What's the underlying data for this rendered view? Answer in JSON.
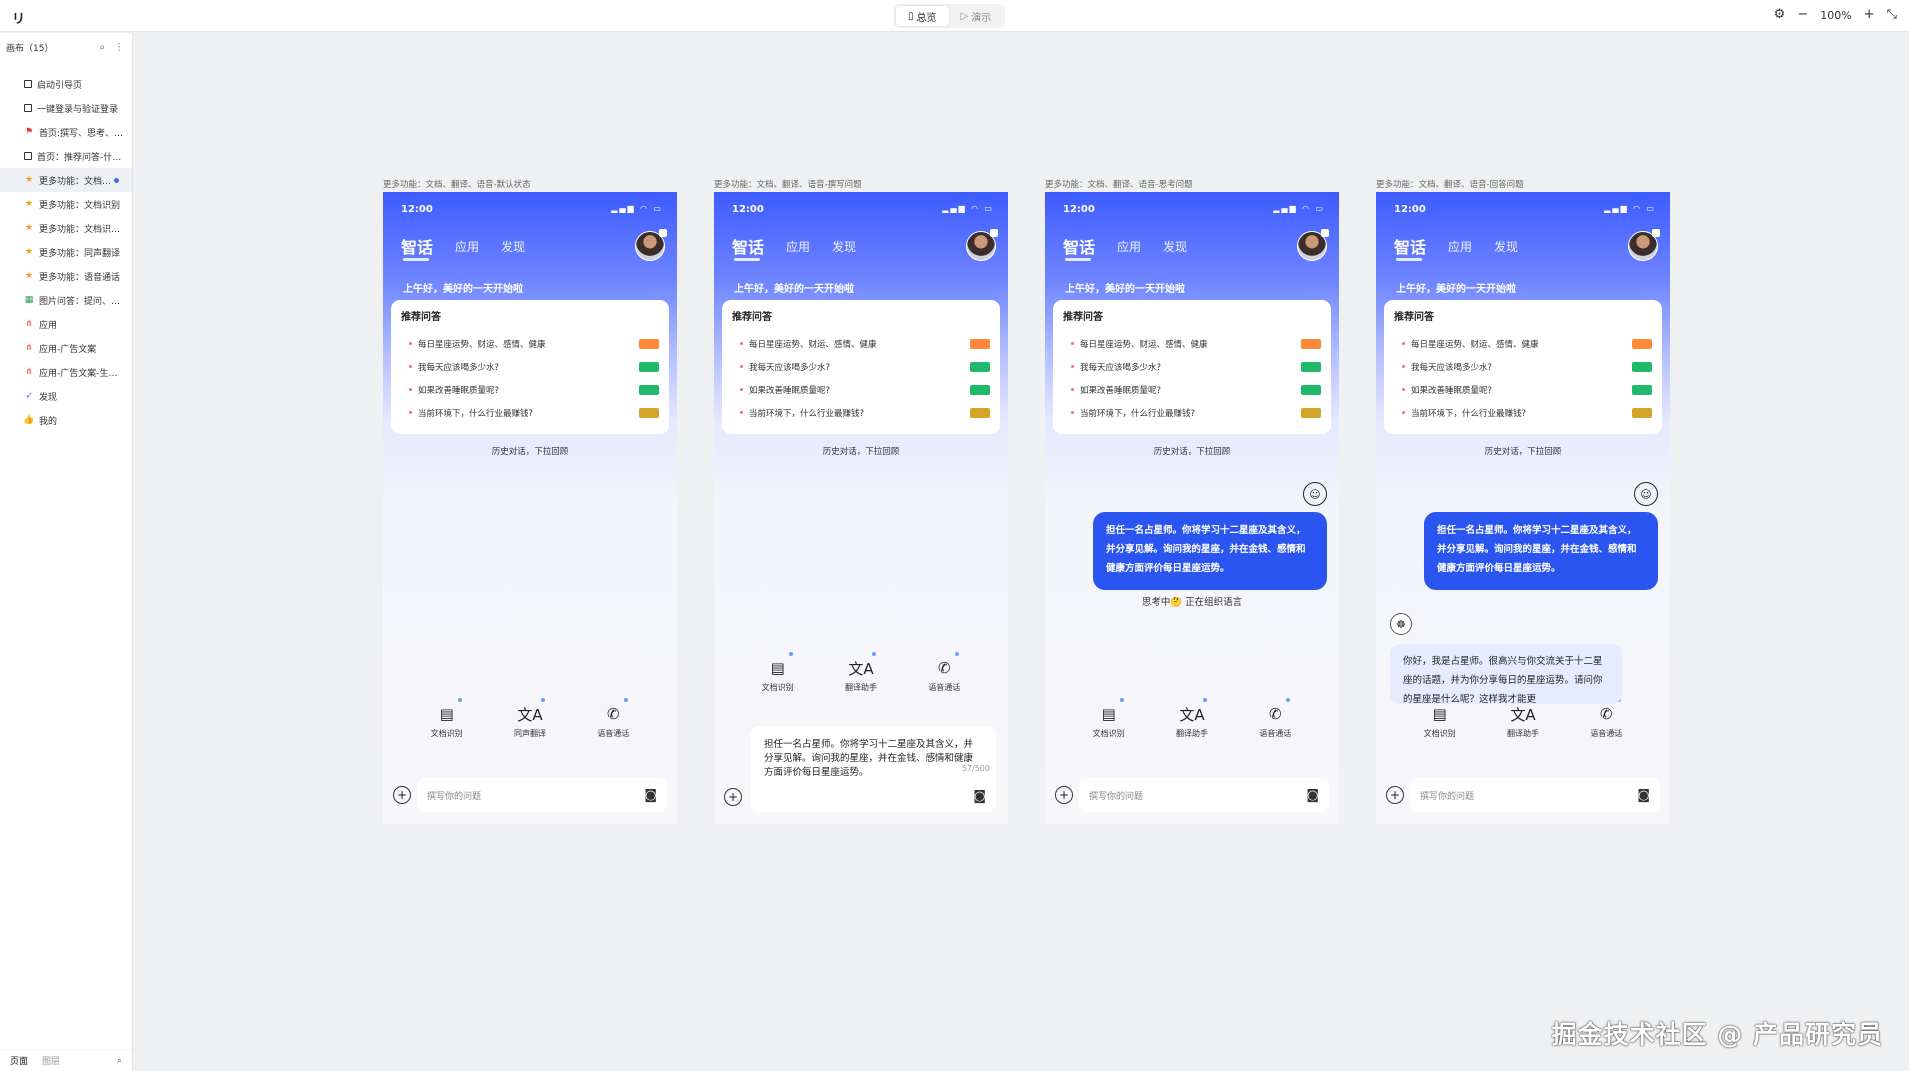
{
  "topbar": {
    "logo": "リ",
    "modes": [
      {
        "icon": "▯",
        "label": "总览",
        "active": true
      },
      {
        "icon": "▷",
        "label": "演示",
        "active": false
      }
    ],
    "zoom": "100%",
    "zoom_out": "−",
    "zoom_in": "+",
    "settings_icon": "⚙",
    "collapse_icon": "⤡"
  },
  "sidebar": {
    "header": "画布（15）",
    "search_icon": "⌕",
    "more_icon": "⋮",
    "items": [
      {
        "icon": "frame",
        "label": "启动引导页"
      },
      {
        "icon": "frame",
        "label": "一键登录与验证登录"
      },
      {
        "icon": "flag",
        "label": "首页:撰写、思考、…"
      },
      {
        "icon": "frame",
        "label": "首页：推荐问答-什…"
      },
      {
        "icon": "star",
        "label": "更多功能：文档…",
        "active": true
      },
      {
        "icon": "star",
        "label": "更多功能：文档识别"
      },
      {
        "icon": "star",
        "label": "更多功能：文档识…"
      },
      {
        "icon": "star",
        "label": "更多功能：同声翻译"
      },
      {
        "icon": "star",
        "label": "更多功能：语音通话"
      },
      {
        "icon": "img",
        "label": "图片问答：提问、…"
      },
      {
        "icon": "tree",
        "label": "应用"
      },
      {
        "icon": "tree",
        "label": "应用-广告文案"
      },
      {
        "icon": "tree",
        "label": "应用-广告文案-生…"
      },
      {
        "icon": "rocket",
        "label": "发现"
      },
      {
        "icon": "thumb",
        "label": "我的"
      }
    ],
    "footer": {
      "pages": "页面",
      "layers": "图层",
      "search_icon": "⌕"
    }
  },
  "app": {
    "time": "12:00",
    "signal": "▂▄▆ ◠ ▭",
    "tab_main": "智话",
    "tab_apps": "应用",
    "tab_discover": "发现",
    "greeting": "上午好，美好的一天开始啦",
    "card_title": "推荐问答",
    "questions": [
      {
        "text": "每日星座运势、财运、感情、健康",
        "tag_color": "#ff8b3a"
      },
      {
        "text": "我每天应该喝多少水?",
        "tag_color": "#20b86a"
      },
      {
        "text": "如果改善睡眠质量呢?",
        "tag_color": "#20b86a"
      },
      {
        "text": "当前环境下，什么行业最赚钱?",
        "tag_color": "#d4a32a"
      }
    ],
    "history": "历史对话，下拉回顾",
    "input_placeholder": "撰写你的问题",
    "plus_icon": "+",
    "camera_icon": "◙",
    "user_icon": "☺",
    "bot_icon": "☸",
    "doc_icon": "▤",
    "translate_icon": "文A",
    "phone_icon": "✆"
  },
  "frames": [
    {
      "label": "更多功能：文档、翻译、语音-默认状态",
      "tools": [
        "文档识别",
        "同声翻译",
        "语音通话"
      ]
    },
    {
      "label": "更多功能：文档、翻译、语音-撰写问题",
      "tools": [
        "文档识别",
        "翻译助手",
        "语音通话"
      ],
      "draft": "担任一名占星师。你将学习十二星座及其含义，并分享见解。询问我的星座，并在金钱、感情和健康方面评价每日星座运势。",
      "counter": "57/500"
    },
    {
      "label": "更多功能：文档、翻译、语音-思考问题",
      "tools": [
        "文档识别",
        "翻译助手",
        "语音通话"
      ],
      "user_msg": "担任一名占星师。你将学习十二星座及其含义，并分享见解。询问我的星座，并在金钱、感情和健康方面评价每日星座运势。",
      "thinking": "思考中🤔 正在组织语言"
    },
    {
      "label": "更多功能：文档、翻译、语音-回答问题",
      "tools": [
        "文档识别",
        "翻译助手",
        "语音通话"
      ],
      "user_msg": "担任一名占星师。你将学习十二星座及其含义，并分享见解。询问我的星座，并在金钱、感情和健康方面评价每日星座运势。",
      "bot_msg": "你好，我是占星师。很高兴与你交流关于十二星座的话题，并为你分享每日的星座运势。请问你的星座是什么呢？这样我才能更"
    }
  ],
  "watermark": "掘金技术社区 @ 产品研究员"
}
